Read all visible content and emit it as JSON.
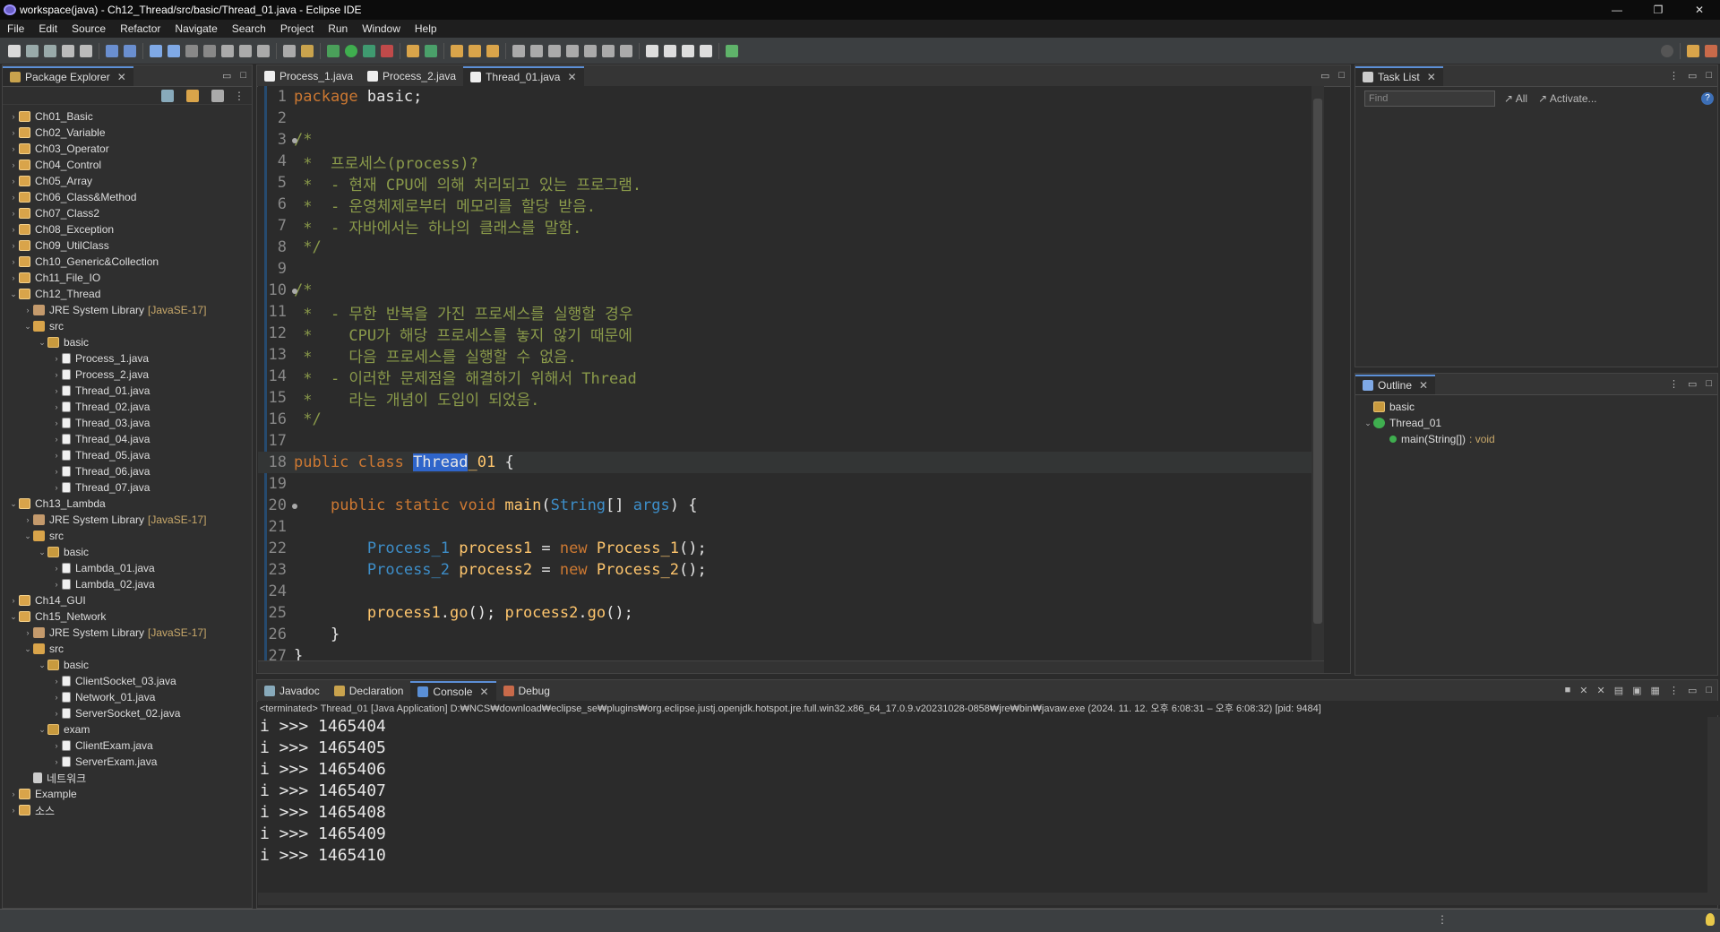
{
  "window": {
    "title": "workspace(java) - Ch12_Thread/src/basic/Thread_01.java - Eclipse IDE",
    "minimize": "—",
    "restore": "❐",
    "close": "✕"
  },
  "menu": [
    "File",
    "Edit",
    "Source",
    "Refactor",
    "Navigate",
    "Search",
    "Project",
    "Run",
    "Window",
    "Help"
  ],
  "package_explorer": {
    "tab": "Package Explorer",
    "items": [
      {
        "label": "Ch01_Basic",
        "level": 0,
        "icon": "proj",
        "arrow": "›"
      },
      {
        "label": "Ch02_Variable",
        "level": 0,
        "icon": "proj",
        "arrow": "›"
      },
      {
        "label": "Ch03_Operator",
        "level": 0,
        "icon": "proj",
        "arrow": "›"
      },
      {
        "label": "Ch04_Control",
        "level": 0,
        "icon": "proj",
        "arrow": "›"
      },
      {
        "label": "Ch05_Array",
        "level": 0,
        "icon": "proj",
        "arrow": "›"
      },
      {
        "label": "Ch06_Class&Method",
        "level": 0,
        "icon": "proj",
        "arrow": "›"
      },
      {
        "label": "Ch07_Class2",
        "level": 0,
        "icon": "proj",
        "arrow": "›"
      },
      {
        "label": "Ch08_Exception",
        "level": 0,
        "icon": "proj",
        "arrow": "›"
      },
      {
        "label": "Ch09_UtilClass",
        "level": 0,
        "icon": "proj",
        "arrow": "›"
      },
      {
        "label": "Ch10_Generic&Collection",
        "level": 0,
        "icon": "proj",
        "arrow": "›"
      },
      {
        "label": "Ch11_File_IO",
        "level": 0,
        "icon": "proj",
        "arrow": "›"
      },
      {
        "label": "Ch12_Thread",
        "level": 0,
        "icon": "proj",
        "arrow": "⌄"
      },
      {
        "label": "JRE System Library",
        "deco": "[JavaSE-17]",
        "level": 1,
        "icon": "lib",
        "arrow": "›"
      },
      {
        "label": "src",
        "level": 1,
        "icon": "src",
        "arrow": "⌄"
      },
      {
        "label": "basic",
        "level": 2,
        "icon": "pkg",
        "arrow": "⌄"
      },
      {
        "label": "Process_1.java",
        "level": 3,
        "icon": "java",
        "arrow": "›"
      },
      {
        "label": "Process_2.java",
        "level": 3,
        "icon": "java",
        "arrow": "›"
      },
      {
        "label": "Thread_01.java",
        "level": 3,
        "icon": "java",
        "arrow": "›"
      },
      {
        "label": "Thread_02.java",
        "level": 3,
        "icon": "java",
        "arrow": "›"
      },
      {
        "label": "Thread_03.java",
        "level": 3,
        "icon": "java",
        "arrow": "›"
      },
      {
        "label": "Thread_04.java",
        "level": 3,
        "icon": "java",
        "arrow": "›"
      },
      {
        "label": "Thread_05.java",
        "level": 3,
        "icon": "java",
        "arrow": "›"
      },
      {
        "label": "Thread_06.java",
        "level": 3,
        "icon": "java",
        "arrow": "›"
      },
      {
        "label": "Thread_07.java",
        "level": 3,
        "icon": "java",
        "arrow": "›"
      },
      {
        "label": "Ch13_Lambda",
        "level": 0,
        "icon": "proj",
        "arrow": "⌄"
      },
      {
        "label": "JRE System Library",
        "deco": "[JavaSE-17]",
        "level": 1,
        "icon": "lib",
        "arrow": "›"
      },
      {
        "label": "src",
        "level": 1,
        "icon": "src",
        "arrow": "⌄"
      },
      {
        "label": "basic",
        "level": 2,
        "icon": "pkg",
        "arrow": "⌄"
      },
      {
        "label": "Lambda_01.java",
        "level": 3,
        "icon": "java",
        "arrow": "›"
      },
      {
        "label": "Lambda_02.java",
        "level": 3,
        "icon": "java",
        "arrow": "›"
      },
      {
        "label": "Ch14_GUI",
        "level": 0,
        "icon": "proj",
        "arrow": "›"
      },
      {
        "label": "Ch15_Network",
        "level": 0,
        "icon": "proj",
        "arrow": "⌄"
      },
      {
        "label": "JRE System Library",
        "deco": "[JavaSE-17]",
        "level": 1,
        "icon": "lib",
        "arrow": "›"
      },
      {
        "label": "src",
        "level": 1,
        "icon": "src",
        "arrow": "⌄"
      },
      {
        "label": "basic",
        "level": 2,
        "icon": "pkg",
        "arrow": "⌄"
      },
      {
        "label": "ClientSocket_03.java",
        "level": 3,
        "icon": "java",
        "arrow": "›"
      },
      {
        "label": "Network_01.java",
        "level": 3,
        "icon": "java",
        "arrow": "›"
      },
      {
        "label": "ServerSocket_02.java",
        "level": 3,
        "icon": "java",
        "arrow": "›"
      },
      {
        "label": "exam",
        "level": 2,
        "icon": "pkg",
        "arrow": "⌄"
      },
      {
        "label": "ClientExam.java",
        "level": 3,
        "icon": "java",
        "arrow": "›"
      },
      {
        "label": "ServerExam.java",
        "level": 3,
        "icon": "java",
        "arrow": "›"
      },
      {
        "label": "네트워크",
        "level": 1,
        "icon": "file",
        "arrow": ""
      },
      {
        "label": "Example",
        "level": 0,
        "icon": "proj",
        "arrow": "›"
      },
      {
        "label": "소스",
        "level": 0,
        "icon": "proj",
        "arrow": "›"
      }
    ]
  },
  "editor": {
    "tabs": [
      {
        "label": "Process_1.java",
        "active": false
      },
      {
        "label": "Process_2.java",
        "active": false
      },
      {
        "label": "Thread_01.java",
        "active": true
      }
    ],
    "lines": [
      {
        "n": "1",
        "html": "<span class='kw'>package</span><span class='pl'> basic;</span>"
      },
      {
        "n": "2",
        "html": ""
      },
      {
        "n": "3",
        "fold": true,
        "html": "<span class='cm'>/*</span>"
      },
      {
        "n": "4",
        "html": "<span class='cm'> *  프로세스(process)?</span>"
      },
      {
        "n": "5",
        "html": "<span class='cm'> *  - 현재 CPU에 의해 처리되고 있는 프로그램.</span>"
      },
      {
        "n": "6",
        "html": "<span class='cm'> *  - 운영체제로부터 메모리를 할당 받음.</span>"
      },
      {
        "n": "7",
        "html": "<span class='cm'> *  - 자바에서는 하나의 클래스를 말함.</span>"
      },
      {
        "n": "8",
        "html": "<span class='cm'> */</span>"
      },
      {
        "n": "9",
        "html": ""
      },
      {
        "n": "10",
        "fold": true,
        "html": "<span class='cm'>/*</span>"
      },
      {
        "n": "11",
        "html": "<span class='cm'> *  - 무한 반복을 가진 프로세스를 실행할 경우</span>"
      },
      {
        "n": "12",
        "html": "<span class='cm'> *    CPU가 해당 프로세스를 놓지 않기 때문에</span>"
      },
      {
        "n": "13",
        "html": "<span class='cm'> *    다음 프로세스를 실행할 수 없음.</span>"
      },
      {
        "n": "14",
        "html": "<span class='cm'> *  - 이러한 문제점을 해결하기 위해서 Thread</span>"
      },
      {
        "n": "15",
        "html": "<span class='cm'> *    라는 개념이 도입이 되었음.</span>"
      },
      {
        "n": "16",
        "html": "<span class='cm'> */</span>"
      },
      {
        "n": "17",
        "html": ""
      },
      {
        "n": "18",
        "cur": true,
        "html": "<span class='kw'>public class </span><span class='hl'>Thread</span><span class='id'>_01</span><span class='pl'> {</span>"
      },
      {
        "n": "19",
        "html": ""
      },
      {
        "n": "20",
        "fold": true,
        "html": "<span class='pl'>    </span><span class='kw'>public static void </span><span class='mt'>main</span><span class='pl'>(</span><span class='ty'>String</span><span class='pl'>[] </span><span class='ty'>args</span><span class='pl'>) {</span>"
      },
      {
        "n": "21",
        "html": ""
      },
      {
        "n": "22",
        "html": "<span class='pl'>        </span><span class='ty'>Process_1</span><span class='pl'> </span><span class='id'>process1</span><span class='pl'> = </span><span class='kw'>new</span><span class='pl'> </span><span class='id'>Process_1</span><span class='pl'>();</span>"
      },
      {
        "n": "23",
        "html": "<span class='pl'>        </span><span class='ty'>Process_2</span><span class='pl'> </span><span class='id'>process2</span><span class='pl'> = </span><span class='kw'>new</span><span class='pl'> </span><span class='id'>Process_2</span><span class='pl'>();</span>"
      },
      {
        "n": "24",
        "html": ""
      },
      {
        "n": "25",
        "html": "<span class='pl'>        </span><span class='id'>process1</span><span class='pl'>.</span><span class='mt'>go</span><span class='pl'>(); </span><span class='id'>process2</span><span class='pl'>.</span><span class='mt'>go</span><span class='pl'>();</span>"
      },
      {
        "n": "26",
        "html": "<span class='pl'>    }</span>"
      },
      {
        "n": "27",
        "html": "<span class='pl'>}</span>"
      }
    ]
  },
  "task_list": {
    "tab": "Task List",
    "find_placeholder": "Find",
    "all": "All",
    "activate": "Activate..."
  },
  "outline": {
    "tab": "Outline",
    "items": [
      {
        "label": "basic",
        "level": 0
      },
      {
        "label": "Thread_01",
        "level": 0,
        "arrow": "⌄"
      },
      {
        "label": "main(String[])",
        "deco": " : void",
        "level": 1
      }
    ]
  },
  "bottom": {
    "tabs": [
      {
        "label": "Javadoc",
        "active": false
      },
      {
        "label": "Declaration",
        "active": false
      },
      {
        "label": "Console",
        "active": true
      },
      {
        "label": "Debug",
        "active": false
      }
    ],
    "path": "<terminated> Thread_01 [Java Application] D:₩NCS₩download₩eclipse_se₩plugins₩org.eclipse.justj.openjdk.hotspot.jre.full.win32.x86_64_17.0.9.v20231028-0858₩jre₩bin₩javaw.exe  (2024. 11. 12. 오후 6:08:31 – 오후 6:08:32) [pid: 9484]",
    "lines": [
      "i >>> 1465404",
      "i >>> 1465405",
      "i >>> 1465406",
      "i >>> 1465407",
      "i >>> 1465408",
      "i >>> 1465409",
      "i >>> 1465410"
    ]
  },
  "colors": {
    "bg": "#2b2b2b",
    "keyword": "#cc7832",
    "comment": "#8a9a4a",
    "type": "#3d8ec9",
    "ident": "#ffc66d",
    "selection": "#2f65ca"
  }
}
